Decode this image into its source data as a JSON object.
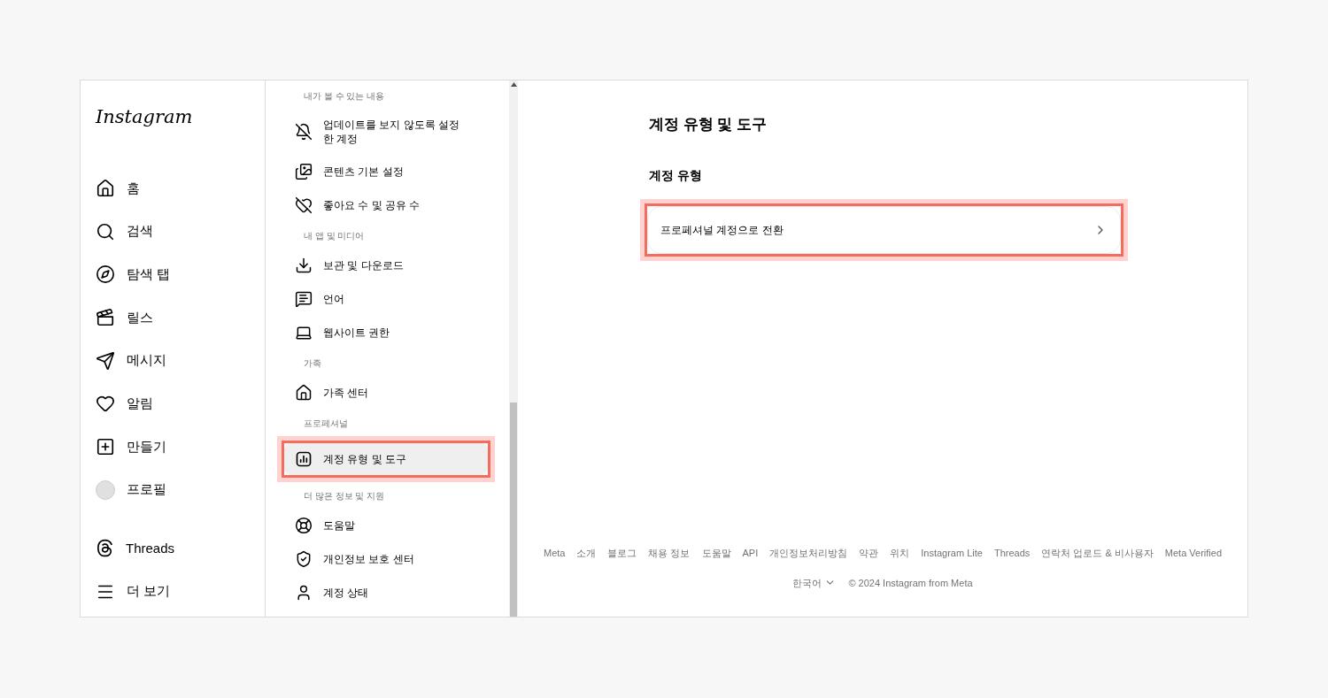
{
  "logo": "Instagram",
  "nav": {
    "items": [
      {
        "label": "홈"
      },
      {
        "label": "검색"
      },
      {
        "label": "탐색 탭"
      },
      {
        "label": "릴스"
      },
      {
        "label": "메시지"
      },
      {
        "label": "알림"
      },
      {
        "label": "만들기"
      },
      {
        "label": "프로필"
      }
    ],
    "bottom": [
      {
        "label": "Threads"
      },
      {
        "label": "더 보기"
      }
    ]
  },
  "settings": {
    "sections": [
      {
        "heading": "내가 볼 수 있는 내용",
        "items": [
          {
            "label": "업데이트를 보지 않도록 설정한 계정",
            "selected": false,
            "highlighted": false
          },
          {
            "label": "콘텐츠 기본 설정",
            "selected": false,
            "highlighted": false
          },
          {
            "label": "좋아요 수 및 공유 수",
            "selected": false,
            "highlighted": false
          }
        ]
      },
      {
        "heading": "내 앱 및 미디어",
        "items": [
          {
            "label": "보관 및 다운로드",
            "selected": false,
            "highlighted": false
          },
          {
            "label": "언어",
            "selected": false,
            "highlighted": false
          },
          {
            "label": "웹사이트 권한",
            "selected": false,
            "highlighted": false
          }
        ]
      },
      {
        "heading": "가족",
        "items": [
          {
            "label": "가족 센터",
            "selected": false,
            "highlighted": false
          }
        ]
      },
      {
        "heading": "프로페셔널",
        "items": [
          {
            "label": "계정 유형 및 도구",
            "selected": true,
            "highlighted": true
          }
        ]
      },
      {
        "heading": "더 많은 정보 및 지원",
        "items": [
          {
            "label": "도움말",
            "selected": false,
            "highlighted": false
          },
          {
            "label": "개인정보 보호 센터",
            "selected": false,
            "highlighted": false
          },
          {
            "label": "계정 상태",
            "selected": false,
            "highlighted": false
          }
        ]
      }
    ]
  },
  "main": {
    "title": "계정 유형 및 도구",
    "section": "계정 유형",
    "option": {
      "label": "프로페셔널 계정으로 전환",
      "highlighted": true
    }
  },
  "footer": {
    "links": [
      "Meta",
      "소개",
      "블로그",
      "채용 정보",
      "도움말",
      "API",
      "개인정보처리방침",
      "약관",
      "위치",
      "Instagram Lite",
      "Threads",
      "연락처 업로드 & 비사용자",
      "Meta Verified"
    ],
    "language": "한국어",
    "copyright": "© 2024 Instagram from Meta"
  }
}
